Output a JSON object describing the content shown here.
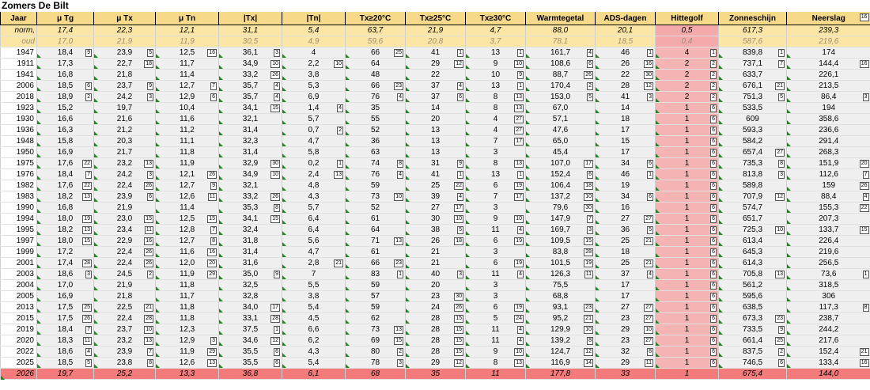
{
  "title": "Zomers De Bilt",
  "columns": [
    "Jaar",
    "μ Tg",
    "μ Tx",
    "μ Tn",
    "|Tx|",
    "|Tn|",
    "Tx≥20°C",
    "Tx≥25°C",
    "Tx≥30°C",
    "Warmtegetal",
    "ADS-dagen",
    "Hittegolf",
    "Zonneschijn",
    "Neerslag"
  ],
  "norm": {
    "label": "norm,",
    "values": [
      "17,4",
      "22,3",
      "12,1",
      "31,1",
      "5,4",
      "63,7",
      "21,9",
      "4,7",
      "88,0",
      "20,1",
      "0,5",
      "617,3",
      "239,3"
    ]
  },
  "oud": {
    "label": "oud",
    "values": [
      "17,0",
      "21,9",
      "11,9",
      "30,5",
      "4,9",
      "59,6",
      "20,8",
      "3,7",
      "78,1",
      "18,5",
      "0,4",
      "587,6",
      "219,6"
    ]
  },
  "rows": [
    {
      "y": "1947",
      "v": [
        "18,4",
        "23,9",
        "12,5",
        "36,1",
        "4",
        "66",
        "41",
        "13",
        "161,7",
        "46",
        "4",
        "839,8",
        "174"
      ],
      "r": [
        "9",
        "5",
        "16",
        "3",
        "",
        "25",
        "1",
        "1",
        "4",
        "1",
        "1",
        "1",
        ""
      ]
    },
    {
      "y": "1911",
      "v": [
        "17,3",
        "22,7",
        "11,7",
        "34,9",
        "2,2",
        "64",
        "29",
        "9",
        "108,6",
        "26",
        "2",
        "737,1",
        "144,4"
      ],
      "r": [
        "",
        "18",
        "",
        "10",
        "10",
        "",
        "12",
        "10",
        "6",
        "16",
        "2",
        "7",
        "16"
      ]
    },
    {
      "y": "1941",
      "v": [
        "16,8",
        "21,8",
        "11,4",
        "33,2",
        "3,8",
        "48",
        "22",
        "10",
        "88,7",
        "22",
        "2",
        "633,7",
        "226,1"
      ],
      "r": [
        "",
        "",
        "",
        "26",
        "",
        "",
        "",
        "9",
        "26",
        "30",
        "2",
        "",
        ""
      ]
    },
    {
      "y": "2006",
      "v": [
        "18,5",
        "23,7",
        "12,7",
        "35,7",
        "5,3",
        "66",
        "37",
        "13",
        "170,4",
        "28",
        "2",
        "676,1",
        "213,5"
      ],
      "r": [
        "6",
        "9",
        "7",
        "4",
        "",
        "23",
        "4",
        "1",
        "2",
        "12",
        "2",
        "21",
        ""
      ]
    },
    {
      "y": "2018",
      "v": [
        "18,9",
        "24,2",
        "12,9",
        "35,7",
        "6,9",
        "76",
        "37",
        "8",
        "153,0",
        "41",
        "2",
        "751,3",
        "86,4"
      ],
      "r": [
        "2",
        "3",
        "6",
        "4",
        "",
        "4",
        "6",
        "13",
        "5",
        "3",
        "2",
        "5",
        "3"
      ]
    },
    {
      "y": "1923",
      "v": [
        "15,2",
        "19,7",
        "10,4",
        "34,1",
        "1,4",
        "35",
        "14",
        "8",
        "67,0",
        "14",
        "1",
        "533,5",
        "194"
      ],
      "r": [
        "",
        "",
        "",
        "15",
        "4",
        "",
        "",
        "13",
        "",
        "",
        "6",
        "",
        ""
      ]
    },
    {
      "y": "1930",
      "v": [
        "16,6",
        "21,6",
        "11,6",
        "32,1",
        "5,7",
        "55",
        "20",
        "4",
        "57,1",
        "18",
        "1",
        "609",
        "358,6"
      ],
      "r": [
        "",
        "",
        "",
        "",
        "",
        "",
        "",
        "27",
        "",
        "",
        "6",
        "",
        ""
      ]
    },
    {
      "y": "1936",
      "v": [
        "16,3",
        "21,2",
        "11,2",
        "31,4",
        "0,7",
        "52",
        "13",
        "4",
        "47,6",
        "17",
        "1",
        "593,3",
        "236,6"
      ],
      "r": [
        "",
        "",
        "",
        "",
        "2",
        "",
        "",
        "27",
        "",
        "",
        "6",
        "",
        ""
      ]
    },
    {
      "y": "1948",
      "v": [
        "15,8",
        "20,3",
        "11,1",
        "32,3",
        "4,7",
        "36",
        "13",
        "7",
        "65,0",
        "15",
        "1",
        "584,2",
        "291,4"
      ],
      "r": [
        "",
        "",
        "",
        "",
        "",
        "",
        "",
        "17",
        "",
        "",
        "6",
        "",
        ""
      ]
    },
    {
      "y": "1950",
      "v": [
        "16,9",
        "21,7",
        "11,8",
        "31,4",
        "5,8",
        "63",
        "13",
        "3",
        "45,4",
        "17",
        "1",
        "657,4",
        "268,3"
      ],
      "r": [
        "",
        "",
        "",
        "",
        "",
        "",
        "",
        "",
        "",
        "",
        "6",
        "27",
        ""
      ]
    },
    {
      "y": "1975",
      "v": [
        "17,6",
        "23,2",
        "11,9",
        "32,9",
        "0,2",
        "74",
        "31",
        "8",
        "107,0",
        "34",
        "1",
        "735,3",
        "151,9"
      ],
      "r": [
        "22",
        "13",
        "",
        "30",
        "1",
        "8",
        "9",
        "13",
        "17",
        "6",
        "6",
        "8",
        "20"
      ]
    },
    {
      "y": "1976",
      "v": [
        "18,4",
        "24,2",
        "12,1",
        "34,9",
        "2,4",
        "76",
        "41",
        "13",
        "152,4",
        "46",
        "1",
        "813,8",
        "112,6"
      ],
      "r": [
        "7",
        "3",
        "26",
        "10",
        "13",
        "4",
        "1",
        "1",
        "6",
        "1",
        "6",
        "3",
        "7"
      ]
    },
    {
      "y": "1982",
      "v": [
        "17,6",
        "22,4",
        "12,7",
        "32,1",
        "4,8",
        "59",
        "25",
        "6",
        "106,4",
        "19",
        "1",
        "589,8",
        "159"
      ],
      "r": [
        "22",
        "26",
        "9",
        "",
        "",
        "",
        "22",
        "19",
        "18",
        "",
        "6",
        "",
        "26"
      ]
    },
    {
      "y": "1983",
      "v": [
        "18,2",
        "23,9",
        "12,6",
        "33,2",
        "4,3",
        "73",
        "39",
        "7",
        "137,2",
        "34",
        "1",
        "707,9",
        "88,4"
      ],
      "r": [
        "13",
        "6",
        "11",
        "26",
        "",
        "10",
        "4",
        "17",
        "10",
        "6",
        "6",
        "12",
        "4"
      ]
    },
    {
      "y": "1990",
      "v": [
        "16,8",
        "21,9",
        "11,4",
        "35,3",
        "5,7",
        "52",
        "27",
        "3",
        "79,6",
        "16",
        "1",
        "574,7",
        "155,3"
      ],
      "r": [
        "",
        "",
        "",
        "8",
        "",
        "",
        "17",
        "",
        "30",
        "",
        "6",
        "",
        "22"
      ]
    },
    {
      "y": "1994",
      "v": [
        "18,0",
        "23,0",
        "12,5",
        "34,1",
        "6,4",
        "61",
        "30",
        "9",
        "147,9",
        "27",
        "1",
        "651,7",
        "207,3"
      ],
      "r": [
        "19",
        "15",
        "15",
        "15",
        "",
        "",
        "10",
        "10",
        "7",
        "27",
        "6",
        "",
        ""
      ]
    },
    {
      "y": "1995",
      "v": [
        "18,2",
        "23,4",
        "12,8",
        "32,4",
        "6,4",
        "64",
        "38",
        "11",
        "169,7",
        "36",
        "1",
        "725,3",
        "133,7"
      ],
      "r": [
        "13",
        "11",
        "7",
        "",
        "",
        "",
        "5",
        "4",
        "3",
        "5",
        "6",
        "10",
        "15"
      ]
    },
    {
      "y": "1997",
      "v": [
        "18,0",
        "22,9",
        "12,7",
        "31,8",
        "5,6",
        "71",
        "26",
        "6",
        "109,5",
        "25",
        "1",
        "613,4",
        "226,4"
      ],
      "r": [
        "15",
        "16",
        "8",
        "",
        "",
        "13",
        "18",
        "19",
        "15",
        "21",
        "6",
        "",
        ""
      ]
    },
    {
      "y": "1999",
      "v": [
        "17,2",
        "22,4",
        "11,6",
        "31,4",
        "4,7",
        "61",
        "21",
        "3",
        "83,8",
        "18",
        "1",
        "645,3",
        "219,6"
      ],
      "r": [
        "",
        "26",
        "16",
        "",
        "",
        "",
        "",
        "",
        "28",
        "",
        "6",
        "",
        ""
      ]
    },
    {
      "y": "2001",
      "v": [
        "17,4",
        "22,4",
        "12,0",
        "31,6",
        "2,8",
        "66",
        "21",
        "6",
        "101,5",
        "25",
        "1",
        "614,3",
        "256,5"
      ],
      "r": [
        "28",
        "26",
        "20",
        "",
        "21",
        "23",
        "",
        "19",
        "19",
        "21",
        "6",
        "",
        ""
      ]
    },
    {
      "y": "2003",
      "v": [
        "18,6",
        "24,5",
        "11,9",
        "35,0",
        "7",
        "83",
        "40",
        "11",
        "126,3",
        "37",
        "1",
        "705,8",
        "73,6"
      ],
      "r": [
        "3",
        "2",
        "29",
        "9",
        "",
        "1",
        "3",
        "4",
        "11",
        "4",
        "6",
        "13",
        "1"
      ]
    },
    {
      "y": "2004",
      "v": [
        "17,0",
        "21,9",
        "11,8",
        "32,5",
        "5,5",
        "59",
        "20",
        "3",
        "75,5",
        "17",
        "1",
        "561,2",
        "318,5"
      ],
      "r": [
        "",
        "",
        "",
        "",
        "",
        "",
        "",
        "",
        "",
        "",
        "6",
        "",
        ""
      ]
    },
    {
      "y": "2005",
      "v": [
        "16,9",
        "21,8",
        "11,7",
        "32,8",
        "3,8",
        "57",
        "23",
        "3",
        "68,8",
        "17",
        "1",
        "595,6",
        "306"
      ],
      "r": [
        "",
        "",
        "",
        "",
        "",
        "",
        "30",
        "",
        "",
        "",
        "6",
        "",
        ""
      ]
    },
    {
      "y": "2013",
      "v": [
        "17,5",
        "22,5",
        "11,8",
        "34,0",
        "5,4",
        "59",
        "24",
        "6",
        "93,1",
        "27",
        "1",
        "638,5",
        "117,3"
      ],
      "r": [
        "25",
        "21",
        "",
        "17",
        "",
        "",
        "26",
        "19",
        "23",
        "27",
        "6",
        "",
        "8"
      ]
    },
    {
      "y": "2015",
      "v": [
        "17,5",
        "22,4",
        "11,8",
        "33,1",
        "4,5",
        "62",
        "28",
        "5",
        "95,2",
        "23",
        "1",
        "673,3",
        "238,7"
      ],
      "r": [
        "26",
        "28",
        "",
        "28",
        "",
        "",
        "15",
        "24",
        "21",
        "27",
        "6",
        "23",
        ""
      ]
    },
    {
      "y": "2019",
      "v": [
        "18,4",
        "23,7",
        "12,3",
        "37,5",
        "6,6",
        "73",
        "28",
        "11",
        "129,9",
        "29",
        "1",
        "733,5",
        "244,2"
      ],
      "r": [
        "7",
        "10",
        "",
        "1",
        "",
        "13",
        "15",
        "4",
        "10",
        "10",
        "6",
        "9",
        ""
      ]
    },
    {
      "y": "2020",
      "v": [
        "18,3",
        "23,2",
        "12,9",
        "34,6",
        "6,2",
        "69",
        "28",
        "11",
        "139,2",
        "23",
        "1",
        "661,4",
        "217,6"
      ],
      "r": [
        "11",
        "13",
        "3",
        "12",
        "",
        "15",
        "15",
        "4",
        "8",
        "27",
        "6",
        "25",
        ""
      ]
    },
    {
      "y": "2022",
      "v": [
        "18,6",
        "23,9",
        "11,9",
        "35,5",
        "4,3",
        "80",
        "28",
        "9",
        "124,7",
        "32",
        "1",
        "837,5",
        "152,4"
      ],
      "r": [
        "4",
        "7",
        "29",
        "6",
        "",
        "2",
        "15",
        "10",
        "12",
        "8",
        "6",
        "2",
        "21"
      ]
    },
    {
      "y": "2025",
      "v": [
        "18,5",
        "23,8",
        "12,6",
        "35,5",
        "5,4",
        "78",
        "29",
        "8",
        "116,9",
        "29",
        "1",
        "746,5",
        "133,4"
      ],
      "r": [
        "5",
        "8",
        "13",
        "6",
        "",
        "3",
        "12",
        "13",
        "14",
        "11",
        "6",
        "6",
        "16"
      ]
    }
  ],
  "current": {
    "y": "2026",
    "v": [
      "19,7",
      "25,2",
      "13,3",
      "36,8",
      "6,1",
      "68",
      "35",
      "11",
      "177,8",
      "33",
      "1",
      "675,4",
      "144,0"
    ],
    "r": [
      "1",
      "1",
      "1",
      "2",
      "",
      "18",
      "8",
      "4",
      "1",
      "8",
      "6",
      "22",
      "16"
    ]
  },
  "colors": {
    "header": "#f7d98a",
    "norm": "#fbe6a6",
    "hittegolf": "#f4b4b4",
    "current": "#f47b7b",
    "cell": "#efefef",
    "marker": "#1a8a1a"
  }
}
